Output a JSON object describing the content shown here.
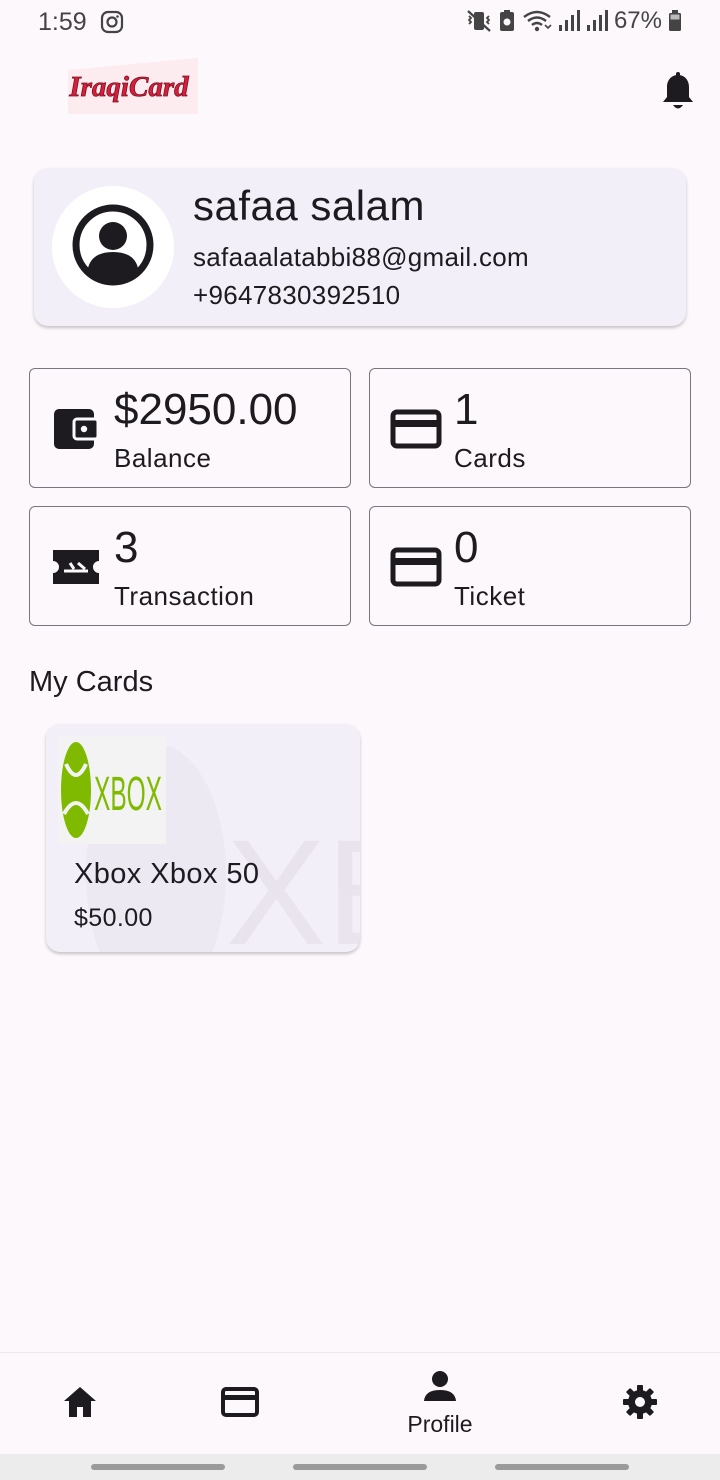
{
  "status_bar": {
    "time": "1:59",
    "battery": "67%"
  },
  "app_bar": {
    "logo_text": "IraqiCard",
    "notification_icon": "bell-icon"
  },
  "profile": {
    "name": "safaa salam",
    "email": "safaaalatabbi88@gmail.com",
    "phone": "+9647830392510",
    "avatar_icon": "account-circle-icon"
  },
  "stats": [
    {
      "icon": "wallet-icon",
      "value": "$2950.00",
      "label": "Balance"
    },
    {
      "icon": "credit-card-icon",
      "value": "1",
      "label": "Cards"
    },
    {
      "icon": "ticket-icon",
      "value": "3",
      "label": "Transaction"
    },
    {
      "icon": "credit-card-icon",
      "value": "0",
      "label": "Ticket"
    }
  ],
  "my_cards": {
    "title": "My Cards",
    "items": [
      {
        "name": "Xbox Xbox 50",
        "price": "$50.00",
        "brand": "XBOX"
      }
    ]
  },
  "bottom_nav": {
    "items": [
      {
        "icon": "home-icon",
        "label": ""
      },
      {
        "icon": "credit-card-icon",
        "label": ""
      },
      {
        "icon": "person-icon",
        "label": "Profile",
        "active": true
      },
      {
        "icon": "gear-icon",
        "label": ""
      }
    ]
  },
  "colors": {
    "background": "#fdf8fc",
    "card_surface": "#f3eff8",
    "outline": "#79747e",
    "text": "#1d1b20",
    "logo_red": "#d61f3c",
    "xbox_green": "#7fba00"
  }
}
